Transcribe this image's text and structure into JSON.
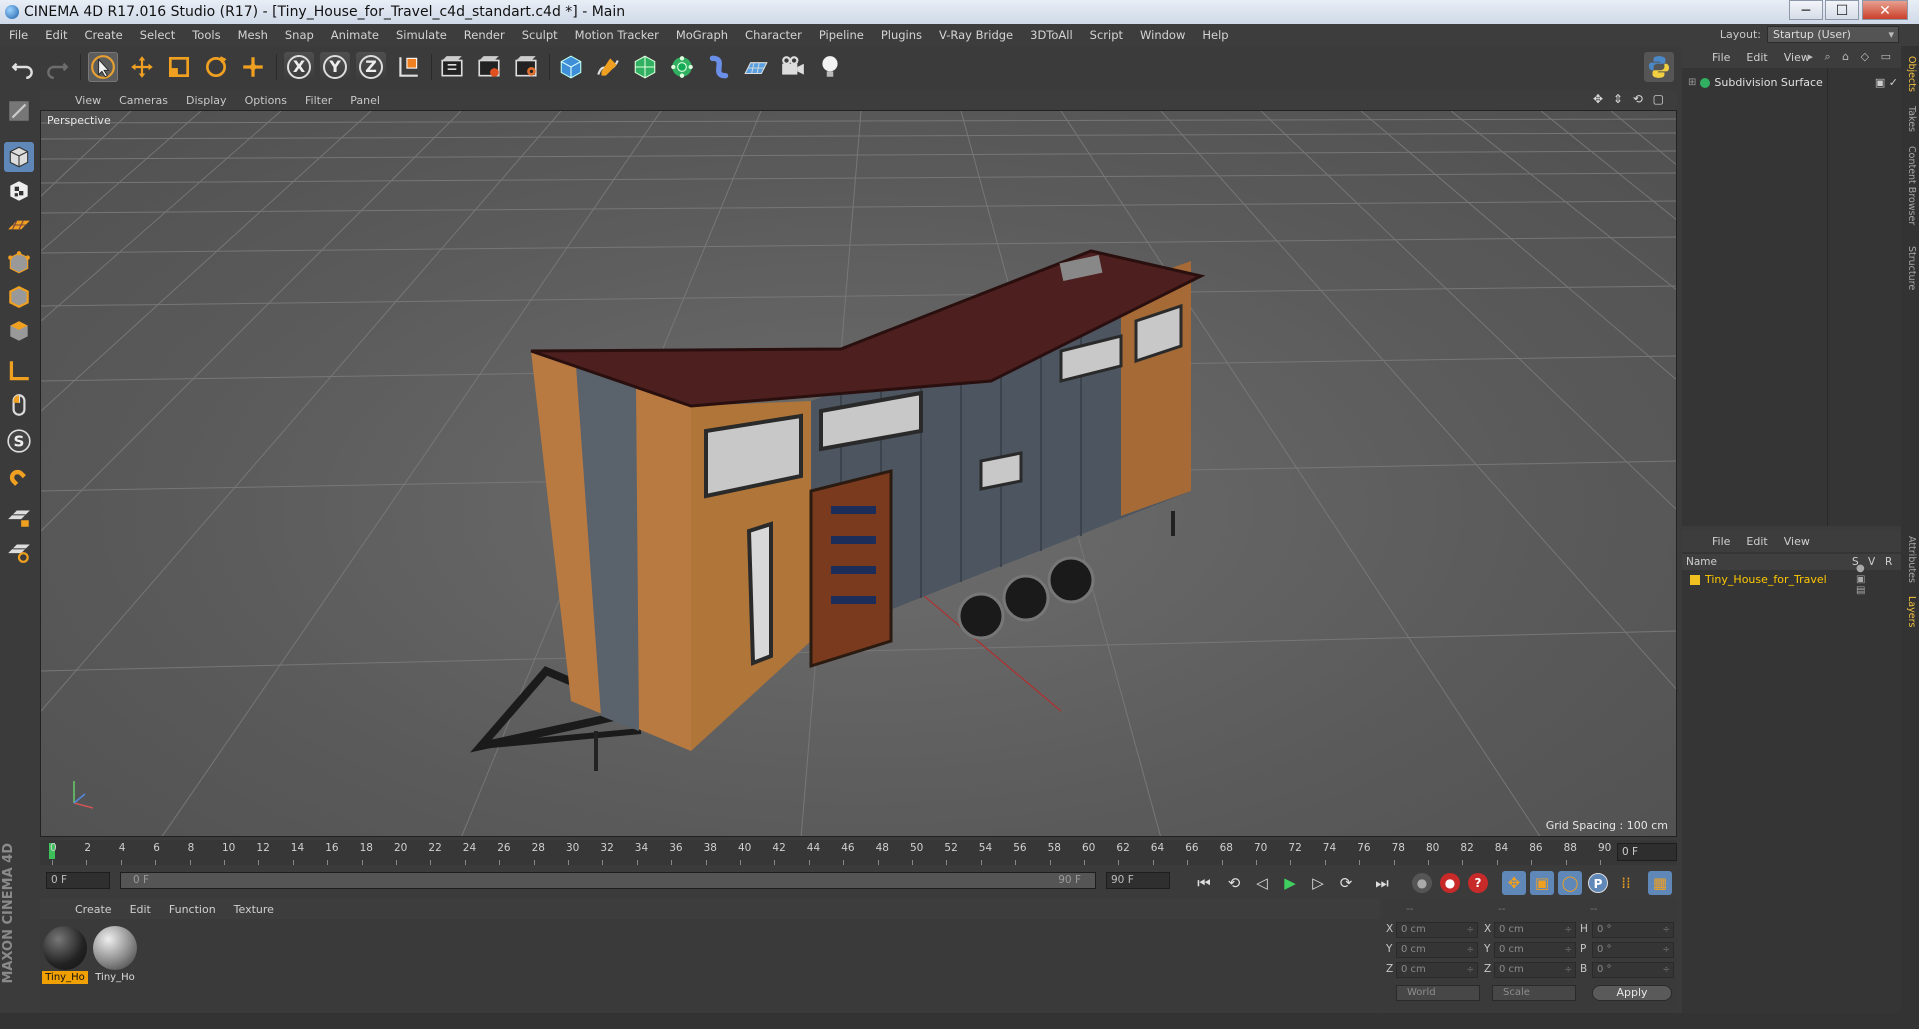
{
  "window": {
    "title": "CINEMA 4D R17.016 Studio (R17) - [Tiny_House_for_Travel_c4d_standart.c4d *] - Main",
    "minimize": "─",
    "maximize": "☐",
    "close": "✕"
  },
  "menubar": {
    "items": [
      "File",
      "Edit",
      "Create",
      "Select",
      "Tools",
      "Mesh",
      "Snap",
      "Animate",
      "Simulate",
      "Render",
      "Sculpt",
      "Motion Tracker",
      "MoGraph",
      "Character",
      "Pipeline",
      "Plugins",
      "V-Ray Bridge",
      "3DToAll",
      "Script",
      "Window",
      "Help"
    ],
    "layout_label": "Layout:",
    "layout_value": "Startup (User)"
  },
  "toolbar": {
    "axis_x": "X",
    "axis_y": "Y",
    "axis_z": "Z"
  },
  "viewport": {
    "menu": [
      "View",
      "Cameras",
      "Display",
      "Options",
      "Filter",
      "Panel"
    ],
    "camera_label": "Perspective",
    "grid_spacing": "Grid Spacing : 100 cm",
    "nav_icons": "✥ ⇕ ⟲ ▢"
  },
  "timeline": {
    "ticks": [
      "0",
      "2",
      "4",
      "6",
      "8",
      "10",
      "12",
      "14",
      "16",
      "18",
      "20",
      "22",
      "24",
      "26",
      "28",
      "30",
      "32",
      "34",
      "36",
      "38",
      "40",
      "42",
      "44",
      "46",
      "48",
      "50",
      "52",
      "54",
      "56",
      "58",
      "60",
      "62",
      "64",
      "66",
      "68",
      "70",
      "72",
      "74",
      "76",
      "78",
      "80",
      "82",
      "84",
      "86",
      "88",
      "90"
    ],
    "current_frame": "0 F"
  },
  "transport": {
    "start_field": "0 F",
    "range_start": "0 F",
    "range_end": "90 F",
    "end_field": "90 F"
  },
  "material_manager": {
    "menu": [
      "Create",
      "Edit",
      "Function",
      "Texture"
    ],
    "materials": [
      {
        "label": "Tiny_Ho",
        "selected": true
      },
      {
        "label": "Tiny_Ho",
        "selected": false
      }
    ]
  },
  "coords": {
    "header_dashes": [
      "--",
      "--",
      "--"
    ],
    "rows": [
      {
        "pos_label": "X",
        "pos": "0 cm",
        "size_label": "X",
        "size": "0 cm",
        "rot_label": "H",
        "rot": "0 °"
      },
      {
        "pos_label": "Y",
        "pos": "0 cm",
        "size_label": "Y",
        "size": "0 cm",
        "rot_label": "P",
        "rot": "0 °"
      },
      {
        "pos_label": "Z",
        "pos": "0 cm",
        "size_label": "Z",
        "size": "0 cm",
        "rot_label": "B",
        "rot": "0 °"
      }
    ],
    "world": "World",
    "scale": "Scale",
    "apply": "Apply"
  },
  "objects_panel": {
    "menu": [
      "File",
      "Edit",
      "View"
    ],
    "object_name": "Subdivision Surface"
  },
  "layers_panel": {
    "menu": [
      "File",
      "Edit",
      "View"
    ],
    "col_name": "Name",
    "col_s": "S",
    "col_v": "V",
    "col_r": "R",
    "layer_name": "Tiny_House_for_Travel",
    "layer_color": "#f0c020"
  },
  "side_tabs": [
    "Objects",
    "Takes",
    "Content Browser",
    "Structure",
    "Attributes",
    "Layers"
  ],
  "brand": {
    "logo": "MAXON CINEMA 4D"
  },
  "colors": {
    "accent": "#5f87b8",
    "selection": "#f0a000"
  }
}
